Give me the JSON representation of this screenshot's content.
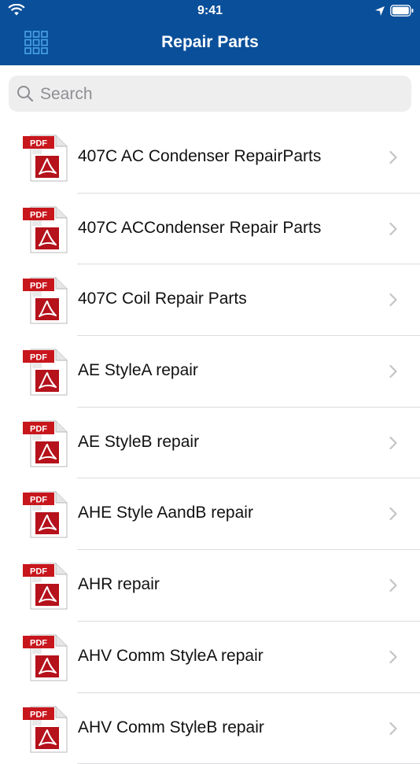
{
  "status_bar": {
    "time": "9:41"
  },
  "header": {
    "title": "Repair Parts"
  },
  "search": {
    "placeholder": "Search",
    "value": ""
  },
  "items": [
    {
      "label": "407C AC Condenser RepairParts",
      "icon": "pdf-icon"
    },
    {
      "label": "407C ACCondenser Repair Parts",
      "icon": "pdf-icon"
    },
    {
      "label": "407C Coil Repair Parts",
      "icon": "pdf-icon"
    },
    {
      "label": "AE StyleA repair",
      "icon": "pdf-icon"
    },
    {
      "label": "AE StyleB repair",
      "icon": "pdf-icon"
    },
    {
      "label": "AHE Style AandB repair",
      "icon": "pdf-icon"
    },
    {
      "label": "AHR repair",
      "icon": "pdf-icon"
    },
    {
      "label": "AHV Comm StyleA repair",
      "icon": "pdf-icon"
    },
    {
      "label": "AHV Comm StyleB repair",
      "icon": "pdf-icon"
    }
  ],
  "pdf_badge_text": "PDF",
  "colors": {
    "nav_bar": "#0a4f9a",
    "grid_icon": "#4aa3e8",
    "pdf_red": "#c8161d"
  }
}
